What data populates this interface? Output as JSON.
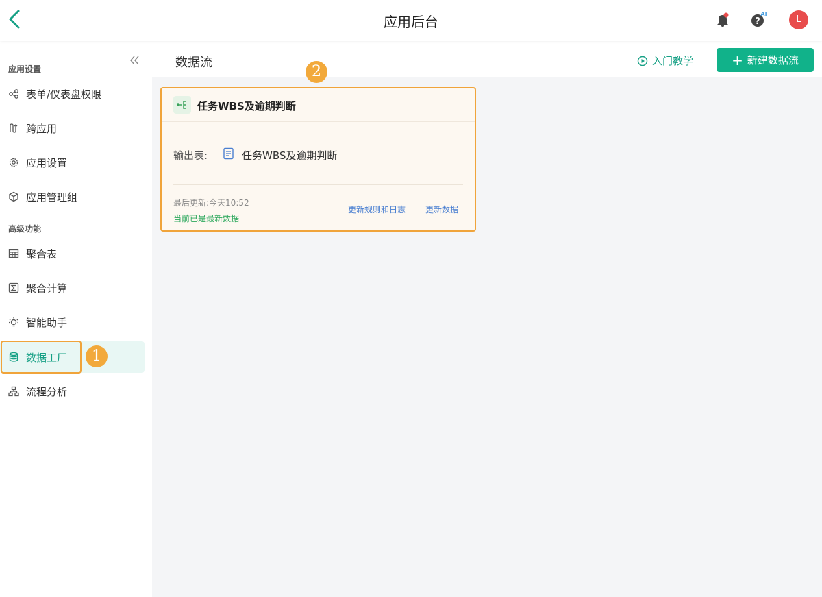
{
  "header": {
    "title": "应用后台",
    "avatar_initial": "L",
    "help_badge": "AI"
  },
  "sidebar": {
    "sections": [
      {
        "title": "应用设置"
      },
      {
        "title": "高级功能"
      }
    ],
    "items": [
      {
        "label": "表单/仪表盘权限",
        "icon": "share-nodes-icon"
      },
      {
        "label": "跨应用",
        "icon": "cross-app-icon"
      },
      {
        "label": "应用设置",
        "icon": "gear-icon"
      },
      {
        "label": "应用管理组",
        "icon": "cube-icon"
      },
      {
        "label": "聚合表",
        "icon": "table-grid-icon"
      },
      {
        "label": "聚合计算",
        "icon": "sigma-icon"
      },
      {
        "label": "智能助手",
        "icon": "lightbulb-icon"
      },
      {
        "label": "数据工厂",
        "icon": "database-icon",
        "active": true
      },
      {
        "label": "流程分析",
        "icon": "org-chart-icon"
      }
    ],
    "step_badge": "1"
  },
  "content": {
    "title": "数据流",
    "tutorial_label": "入门教学",
    "new_button_label": "新建数据流",
    "step_badge": "2",
    "card": {
      "title": "任务WBS及逾期判断",
      "output_label": "输出表:",
      "output_value": "任务WBS及逾期判断",
      "last_update": "最后更新:今天10:52",
      "status": "当前已是最新数据",
      "link_rules": "更新规则和日志",
      "link_refresh": "更新数据"
    }
  },
  "colors": {
    "accent": "#11b28a",
    "highlight": "#f0a43b",
    "link": "#4a7fd1",
    "avatar": "#e84c4c"
  }
}
